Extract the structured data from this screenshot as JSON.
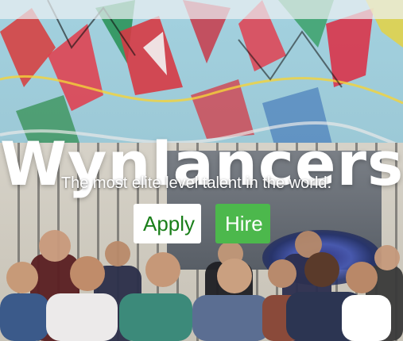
{
  "hero": {
    "brand": "Wynlancers",
    "tagline": "The most elite level talent in the world.",
    "background": "team-photo-in-front-of-graffiti-mural"
  },
  "actions": {
    "apply_label": "Apply",
    "hire_label": "Hire"
  },
  "colors": {
    "apply_text": "#1a7f1a",
    "hire_background": "#4cb84c",
    "title_text": "#ffffff"
  }
}
